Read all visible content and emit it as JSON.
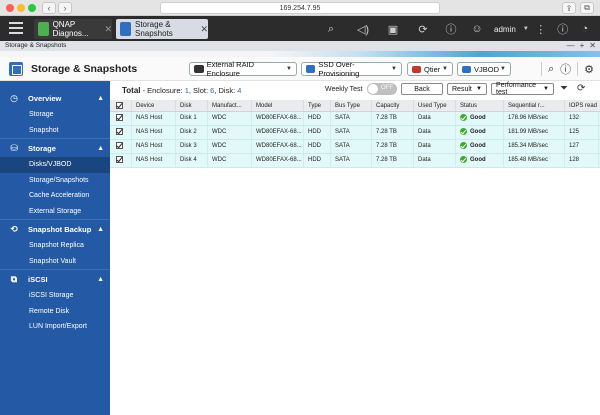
{
  "browser": {
    "url": "169.254.7.95",
    "back_icon": "chevron-left-icon",
    "forward_icon": "chevron-right-icon"
  },
  "qts": {
    "tabs": [
      {
        "label": "QNAP Diagnos...",
        "icon_color": "#4caf50"
      },
      {
        "label": "Storage & Snapshots",
        "icon_color": "#2e6ec3"
      }
    ],
    "user": "admin",
    "icons": [
      "search-icon",
      "volume-icon",
      "notification-icon",
      "sync-icon",
      "alert-icon",
      "user-icon",
      "more-icon",
      "info-icon",
      "dashboard-icon"
    ]
  },
  "window": {
    "title": "Storage & Snapshots",
    "controls": [
      "—",
      "+",
      "✕"
    ]
  },
  "app": {
    "title": "Storage & Snapshots",
    "buttons": {
      "enclosure": "External RAID Enclosure",
      "ssd": "SSD Over-Provisioning",
      "qtier": "Qtier",
      "vjbod": "VJBOD"
    }
  },
  "sidebar": {
    "sections": [
      {
        "label": "Overview",
        "icon": "clock-icon",
        "items": [
          "Storage",
          "Snapshot"
        ]
      },
      {
        "label": "Storage",
        "icon": "database-icon",
        "items": [
          "Disks/VJBOD",
          "Storage/Snapshots",
          "Cache Acceleration",
          "External Storage"
        ]
      },
      {
        "label": "Snapshot Backup",
        "icon": "snapshot-icon",
        "items": [
          "Snapshot Replica",
          "Snapshot Vault"
        ]
      },
      {
        "label": "iSCSI",
        "icon": "iscsi-icon",
        "items": [
          "iSCSI Storage",
          "Remote Disk",
          "LUN Import/Export"
        ]
      }
    ],
    "active_item": "Disks/VJBOD"
  },
  "toolbar": {
    "total_label": "Total",
    "enclosure_label": " - Enclosure: ",
    "enclosure_value": "1",
    "slot_label": ", Slot: ",
    "slot_value": "6",
    "disk_label": ", Disk: ",
    "disk_value": "4",
    "weekly_test_label": "Weekly Test",
    "weekly_test_state": "OFF",
    "back_label": "Back",
    "result_label": "Result",
    "perf_label": "Performance test"
  },
  "table": {
    "columns": [
      "Device",
      "Disk",
      "Manufact...",
      "Model",
      "Type",
      "Bus Type",
      "Capacity",
      "Used Type",
      "Status",
      "Sequential r...",
      "IOPS read r..."
    ],
    "rows": [
      {
        "device": "NAS Host",
        "disk": "Disk 1",
        "manufacturer": "WDC",
        "model": "WD80EFAX-68...",
        "type": "HDD",
        "bus": "SATA",
        "capacity": "7.28 TB",
        "used": "Data",
        "status": "Good",
        "seq": "178.96 MB/sec",
        "iops": "132"
      },
      {
        "device": "NAS Host",
        "disk": "Disk 2",
        "manufacturer": "WDC",
        "model": "WD80EFAX-68...",
        "type": "HDD",
        "bus": "SATA",
        "capacity": "7.28 TB",
        "used": "Data",
        "status": "Good",
        "seq": "181.99 MB/sec",
        "iops": "125"
      },
      {
        "device": "NAS Host",
        "disk": "Disk 3",
        "manufacturer": "WDC",
        "model": "WD80EFAX-68...",
        "type": "HDD",
        "bus": "SATA",
        "capacity": "7.28 TB",
        "used": "Data",
        "status": "Good",
        "seq": "185.34 MB/sec",
        "iops": "127"
      },
      {
        "device": "NAS Host",
        "disk": "Disk 4",
        "manufacturer": "WDC",
        "model": "WD80EFAX-68...",
        "type": "HDD",
        "bus": "SATA",
        "capacity": "7.28 TB",
        "used": "Data",
        "status": "Good",
        "seq": "185.48 MB/sec",
        "iops": "128"
      }
    ]
  },
  "colors": {
    "sidebar": "#245aa5",
    "sidebar_active": "#1a4680",
    "row_bg": "#e3f8f8",
    "good": "#3cab2d",
    "accent": "#2d68b0"
  }
}
